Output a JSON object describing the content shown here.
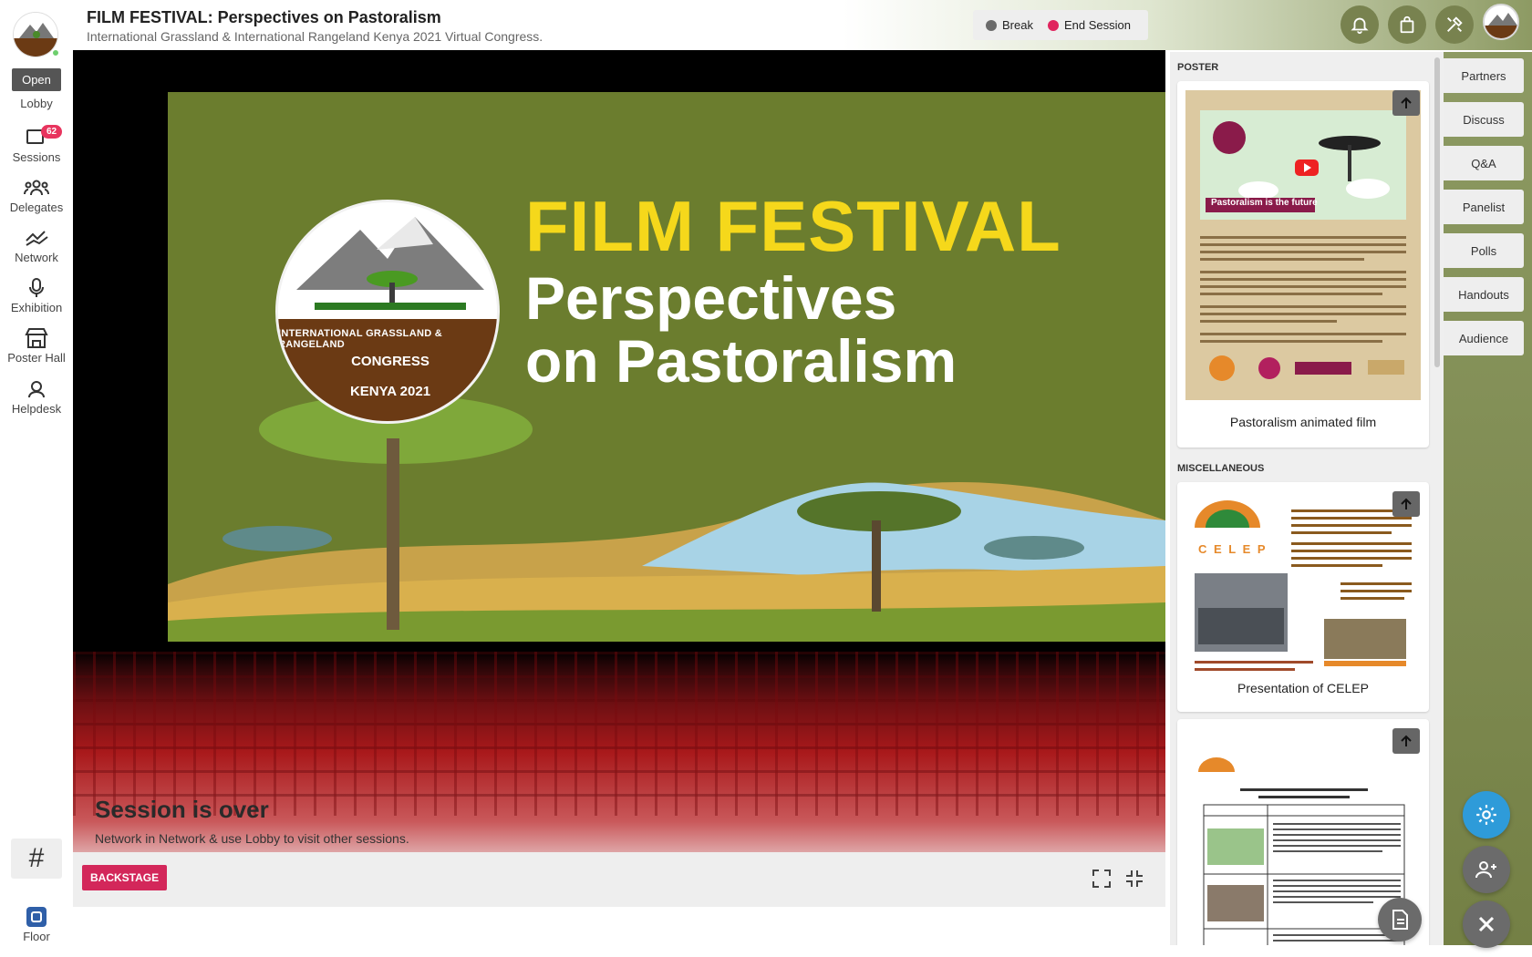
{
  "header": {
    "title": "FILM FESTIVAL: Perspectives on Pastoralism",
    "subtitle": "International Grassland & International Rangeland Kenya 2021 Virtual Congress.",
    "break_label": "Break",
    "end_label": "End Session"
  },
  "nav": {
    "tooltip": "Open",
    "items": [
      {
        "label": "Lobby"
      },
      {
        "label": "Sessions",
        "badge": "62"
      },
      {
        "label": "Delegates"
      },
      {
        "label": "Network"
      },
      {
        "label": "Exhibition"
      },
      {
        "label": "Poster Hall"
      },
      {
        "label": "Helpdesk"
      }
    ],
    "hash": "#",
    "floor": "Floor"
  },
  "stage": {
    "film_line1": "FILM FESTIVAL",
    "film_line2": "Perspectives",
    "film_line3": "on Pastoralism",
    "emblem_line1": "INTERNATIONAL GRASSLAND & RANGELAND",
    "emblem_line2": "CONGRESS",
    "emblem_line3": "KENYA 2021",
    "status_title": "Session is over",
    "status_text": "Network in Network & use Lobby to visit other sessions.",
    "backstage": "BACKSTAGE"
  },
  "handouts": {
    "section1": "POSTER",
    "card1_caption": "Pastoralism animated film",
    "card1_banner": "Pastoralism is the future",
    "section2": "MISCELLANEOUS",
    "card2_caption": "Presentation of CELEP",
    "card2_logo": "C E L E P"
  },
  "tabs": [
    "Partners",
    "Discuss",
    "Q&A",
    "Panelist",
    "Polls",
    "Handouts",
    "Audience"
  ],
  "colors": {
    "accent_olive": "#78824f",
    "backstage_red": "#d3275a",
    "end_dot": "#e0245e",
    "break_dot": "#6b6b6b",
    "fab_blue": "#2e9bd9",
    "fab_grey": "#6b6b6b"
  },
  "icons": {
    "top": [
      "bell-icon",
      "shopping-bag-icon",
      "tools-icon"
    ],
    "fabs": [
      "gear-icon",
      "add-user-icon",
      "close-icon"
    ]
  }
}
